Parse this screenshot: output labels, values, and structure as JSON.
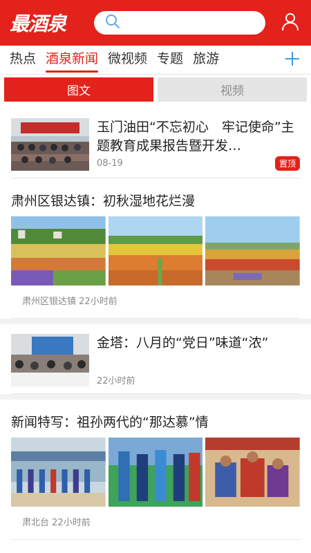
{
  "header": {
    "logo_text": "最酒泉",
    "search_placeholder": "",
    "brand_color": "#e3221b"
  },
  "tabs": [
    {
      "label": "热点",
      "active": false
    },
    {
      "label": "酒泉新闻",
      "active": true
    },
    {
      "label": "微视频",
      "active": false
    },
    {
      "label": "专题",
      "active": false
    },
    {
      "label": "旅游",
      "active": false
    }
  ],
  "segment": {
    "image_text": "图文",
    "video": "视频"
  },
  "feed": [
    {
      "title": "玉门油田“不忘初心　牢记使命”主题教育成果报告暨开发…",
      "date": "08-19",
      "badge": "置顶"
    },
    {
      "title": "肃州区银达镇：初秋湿地花烂漫",
      "source": "肃州区银达镇",
      "time": "22小时前"
    },
    {
      "title": "金塔：八月的“党日”味道“浓”",
      "time": "22小时前"
    },
    {
      "title": "新闻特写：祖孙两代的“那达慕”情",
      "source": "肃北台",
      "time": "22小时前"
    }
  ]
}
